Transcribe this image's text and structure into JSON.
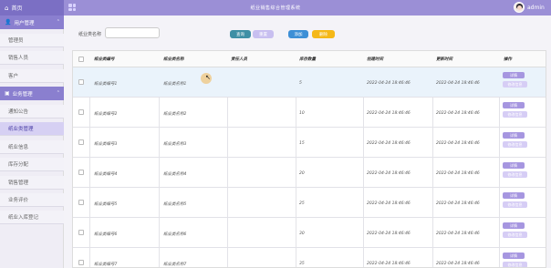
{
  "app": {
    "home_label": "首页",
    "title": "纸业销售综合管理系统",
    "user": "admin",
    "colors": {
      "accent": "#9b8fd6",
      "sidebar_group": "#8a7fcf",
      "search": "#3f8fa5",
      "add": "#3d8fd6",
      "delete": "#f5b818",
      "detail": "#a696e0"
    }
  },
  "sidebar": {
    "groups": [
      {
        "label": "用户管理",
        "icon": "users-icon",
        "items": [
          {
            "label": "管理员"
          },
          {
            "label": "销售人员"
          },
          {
            "label": "客户"
          }
        ]
      },
      {
        "label": "业务管理",
        "icon": "briefcase-icon",
        "items": [
          {
            "label": "通知公告"
          },
          {
            "label": "纸业类管理"
          },
          {
            "label": "纸业信息"
          },
          {
            "label": "库存分配"
          },
          {
            "label": "销售管理"
          },
          {
            "label": "业务评价"
          },
          {
            "label": "纸业入库登记"
          }
        ]
      }
    ],
    "active_item": "纸业类管理"
  },
  "search": {
    "label": "纸业类名称",
    "placeholder": "",
    "value": "",
    "buttons": {
      "search": "查询",
      "reset": "重置",
      "add": "添加",
      "delete": "删除"
    }
  },
  "table": {
    "headers": [
      "纸业类编号",
      "纸业类名称",
      "责任人员",
      "库存数量",
      "创建时间",
      "更新时间",
      "操作"
    ],
    "rows": [
      {
        "id": "纸业类编号1",
        "name": "纸业类名称1",
        "person": "",
        "qty": "5",
        "created": "2022-04-24 18:46:46",
        "updated": "2022-04-24 18:46:46"
      },
      {
        "id": "纸业类编号2",
        "name": "纸业类名称2",
        "person": "",
        "qty": "10",
        "created": "2022-04-24 18:46:46",
        "updated": "2022-04-24 18:46:46"
      },
      {
        "id": "纸业类编号3",
        "name": "纸业类名称3",
        "person": "",
        "qty": "15",
        "created": "2022-04-24 18:46:46",
        "updated": "2022-04-24 18:46:46"
      },
      {
        "id": "纸业类编号4",
        "name": "纸业类名称4",
        "person": "",
        "qty": "20",
        "created": "2022-04-24 18:46:46",
        "updated": "2022-04-24 18:46:46"
      },
      {
        "id": "纸业类编号5",
        "name": "纸业类名称5",
        "person": "",
        "qty": "25",
        "created": "2022-04-24 18:46:46",
        "updated": "2022-04-24 18:46:46"
      },
      {
        "id": "纸业类编号6",
        "name": "纸业类名称6",
        "person": "",
        "qty": "30",
        "created": "2022-04-24 18:46:46",
        "updated": "2022-04-24 18:46:46"
      },
      {
        "id": "纸业类编号7",
        "name": "纸业类名称7",
        "person": "",
        "qty": "35",
        "created": "2022-04-24 18:46:46",
        "updated": "2022-04-24 18:46:46"
      }
    ],
    "actions": {
      "detail": "详情",
      "edit": "修改信息"
    }
  }
}
